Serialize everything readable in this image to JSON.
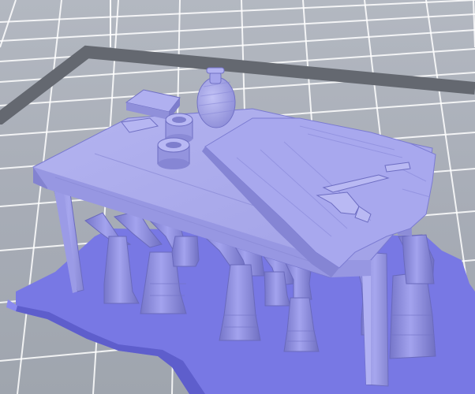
{
  "viewport": {
    "kind": "3d-print-slicer-preview",
    "colors": {
      "background": "#a9aeb8",
      "grid_line": "#ffffff",
      "build_plate_border": "#646870",
      "model_fill": "#a3a3ec",
      "model_shadow": "#8585d6",
      "support_raft": "#7c7ce8",
      "support_tree": "#8f8fe0"
    },
    "objects": [
      "build-plate-grid",
      "support-raft",
      "tree-supports",
      "table-model",
      "bottle-model",
      "cup-models",
      "book-model",
      "tablecloth-model",
      "key-model"
    ]
  }
}
